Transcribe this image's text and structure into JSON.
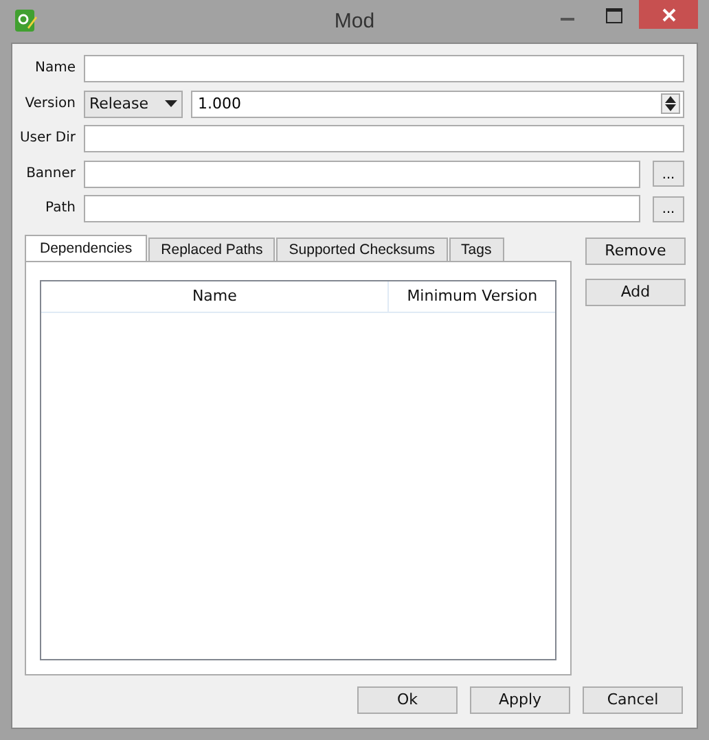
{
  "window": {
    "title": "Mod"
  },
  "fields": [
    {
      "kind": "text",
      "label": "Name"
    },
    {
      "kind": "version",
      "label": "Version",
      "combo": "Release",
      "value": "1.000"
    },
    {
      "kind": "text",
      "label": "User Dir"
    },
    {
      "kind": "browse",
      "label": "Banner",
      "button": "..."
    },
    {
      "kind": "browse",
      "label": "Path",
      "button": "..."
    }
  ],
  "tabs": [
    {
      "label": "Dependencies",
      "selected": true
    },
    {
      "label": "Replaced Paths",
      "selected": false
    },
    {
      "label": "Supported Checksums",
      "selected": false
    },
    {
      "label": "Tags",
      "selected": false
    }
  ],
  "table": {
    "columns": [
      "Name",
      "Minimum Version"
    ]
  },
  "side_buttons": [
    "Remove",
    "Add"
  ],
  "buttons": [
    "Ok",
    "Apply",
    "Cancel"
  ]
}
